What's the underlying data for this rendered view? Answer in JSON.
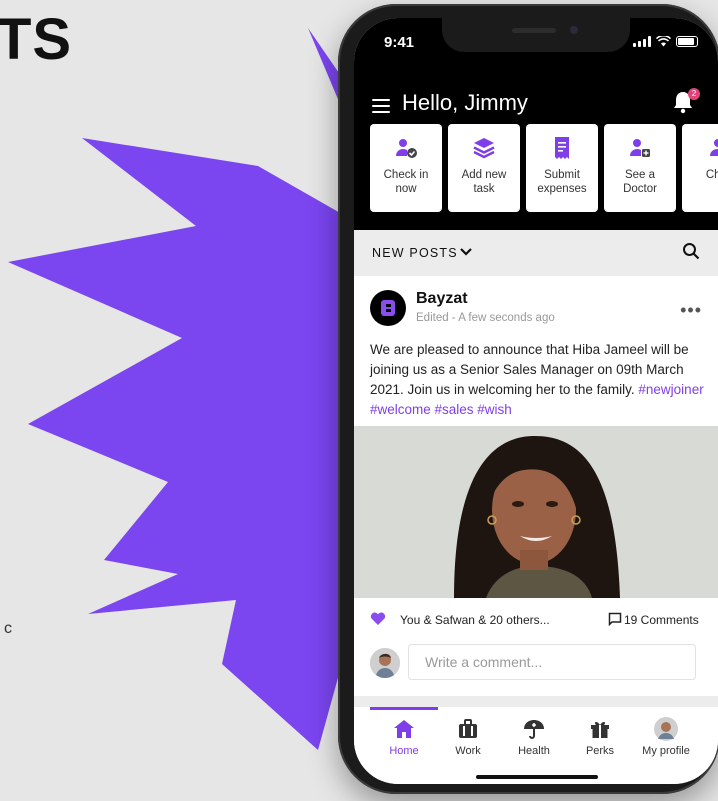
{
  "background": {
    "title_fragment": "TS",
    "edge_mark": "c",
    "accent_color": "#7b45f0"
  },
  "status_bar": {
    "time": "9:41"
  },
  "header": {
    "greeting": "Hello, Jimmy",
    "notification_count": "2",
    "quick_actions": [
      {
        "label": "Check in now",
        "icon": "user-check-icon"
      },
      {
        "label": "Add new task",
        "icon": "layers-icon"
      },
      {
        "label": "Submit expenses",
        "icon": "receipt-icon"
      },
      {
        "label": "See a Doctor",
        "icon": "doctor-icon"
      },
      {
        "label": "Ch...",
        "icon": "user-icon"
      }
    ]
  },
  "feed": {
    "filter_label": "NEW POSTS",
    "post": {
      "author": "Bayzat",
      "author_initial": "B",
      "meta": "Edited - A few seconds ago",
      "text": "We are pleased to announce that Hiba Jameel will be joining us as a Senior Sales Manager on 09th March 2021. Join us in welcoming her to the family.",
      "hashtags": "#newjoiner #welcome #sales #wish",
      "likes": "You & Safwan & 20 others...",
      "comments": "19 Comments"
    },
    "comment_placeholder": "Write a comment..."
  },
  "tabbar": {
    "items": [
      {
        "label": "Home",
        "icon": "home-icon",
        "active": true
      },
      {
        "label": "Work",
        "icon": "briefcase-icon",
        "active": false
      },
      {
        "label": "Health",
        "icon": "umbrella-icon",
        "active": false
      },
      {
        "label": "Perks",
        "icon": "gift-icon",
        "active": false
      },
      {
        "label": "My profile",
        "icon": "avatar-icon",
        "active": false
      }
    ]
  },
  "colors": {
    "accent": "#7f3ee8",
    "header_bg": "#000000",
    "badge": "#e0447a"
  }
}
